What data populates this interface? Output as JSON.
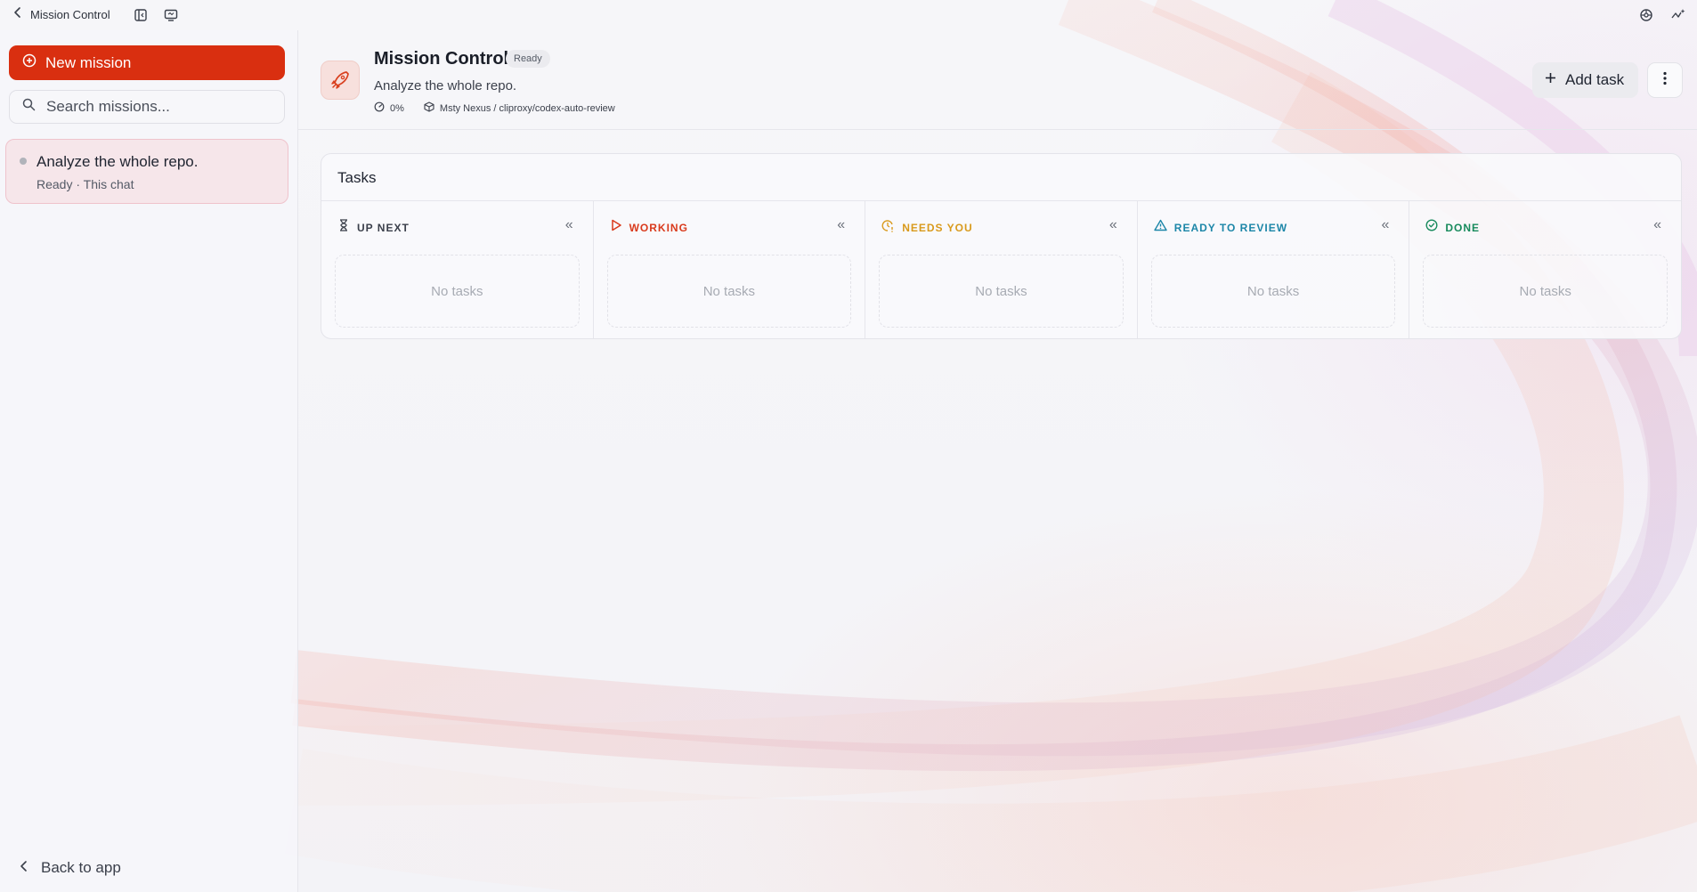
{
  "topbar": {
    "back_label": "Mission Control"
  },
  "sidebar": {
    "new_mission_label": "New mission",
    "search_placeholder": "Search missions...",
    "missions": [
      {
        "title": "Analyze the whole repo.",
        "subtitle": "Ready · This chat"
      }
    ],
    "back_to_app_label": "Back to app"
  },
  "header": {
    "title": "Mission Control",
    "status_badge": "Ready",
    "description": "Analyze the whole repo.",
    "progress": "0%",
    "repo": "Msty Nexus / cliproxy/codex-auto-review",
    "add_task_label": "Add task"
  },
  "tasks": {
    "title": "Tasks",
    "columns": [
      {
        "label": "UP NEXT",
        "empty": "No tasks",
        "color": "#3a3f4a",
        "icon": "hourglass-icon"
      },
      {
        "label": "WORKING",
        "empty": "No tasks",
        "color": "#d93a1c",
        "icon": "play-icon"
      },
      {
        "label": "NEEDS YOU",
        "empty": "No tasks",
        "color": "#d99a1c",
        "icon": "clock-alert-icon"
      },
      {
        "label": "READY TO REVIEW",
        "empty": "No tasks",
        "color": "#1c86a8",
        "icon": "warning-triangle-icon"
      },
      {
        "label": "DONE",
        "empty": "No tasks",
        "color": "#178a5c",
        "icon": "check-circle-icon"
      }
    ]
  },
  "colors": {
    "accent": "#d92f10"
  }
}
